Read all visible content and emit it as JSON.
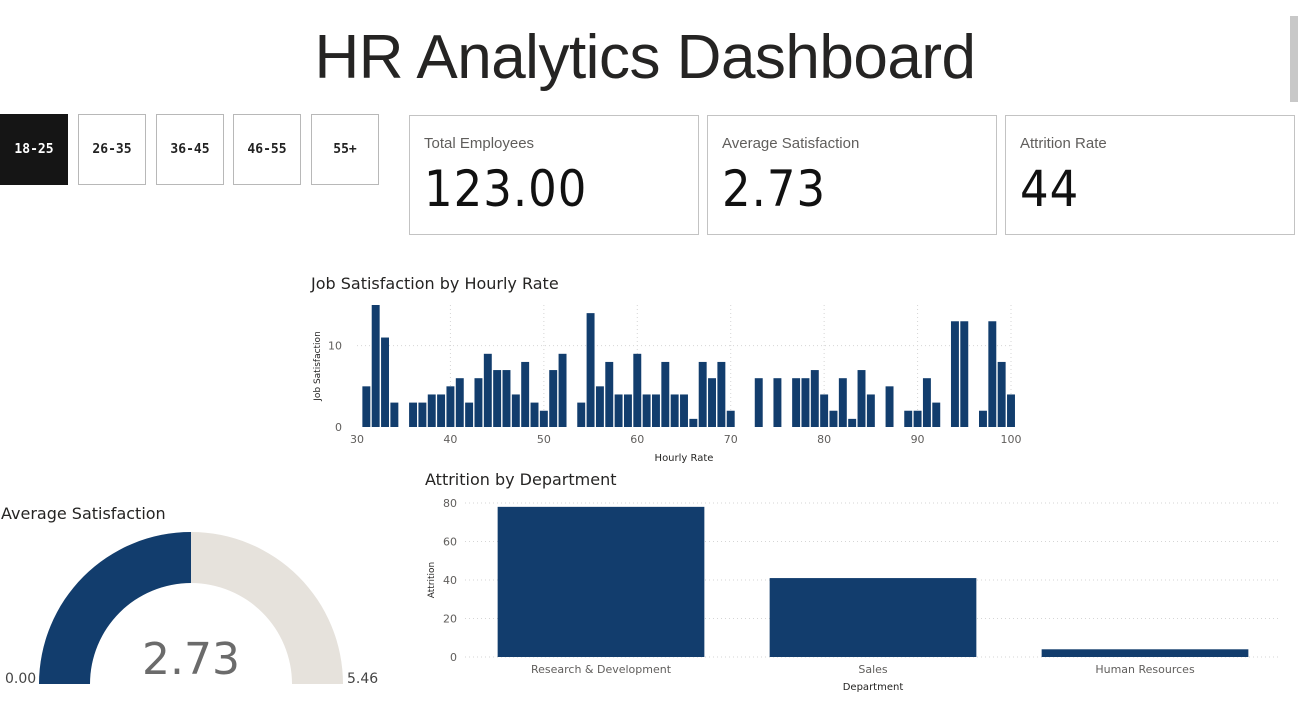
{
  "header": {
    "title": "HR Analytics Dashboard"
  },
  "age_filter": {
    "options": [
      "18-25",
      "26-35",
      "36-45",
      "46-55",
      "55+"
    ],
    "selected": "18-25"
  },
  "kpis": [
    {
      "label": "Total Employees",
      "value": "123.00"
    },
    {
      "label": "Average Satisfaction",
      "value": "2.73"
    },
    {
      "label": "Attrition Rate",
      "value": "44"
    }
  ],
  "colors": {
    "bar": "#123d6d",
    "gauge_empty": "#e6e2dc",
    "selected_button": "#151515"
  },
  "chart_data": [
    {
      "type": "bar",
      "title": "Job Satisfaction by Hourly Rate",
      "xlabel": "Hourly Rate",
      "ylabel": "Job Satisfaction",
      "xlim": [
        30,
        100
      ],
      "ylim": [
        0,
        15
      ],
      "x_ticks": [
        30,
        40,
        50,
        60,
        70,
        80,
        90,
        100
      ],
      "y_ticks": [
        0,
        10
      ],
      "x": [
        31,
        32,
        33,
        34,
        36,
        37,
        38,
        39,
        40,
        41,
        42,
        43,
        44,
        45,
        46,
        47,
        48,
        49,
        50,
        51,
        52,
        54,
        55,
        56,
        57,
        58,
        59,
        60,
        61,
        62,
        63,
        64,
        65,
        66,
        67,
        68,
        69,
        70,
        73,
        75,
        77,
        78,
        79,
        80,
        81,
        82,
        83,
        84,
        85,
        87,
        89,
        90,
        91,
        92,
        94,
        95,
        97,
        98,
        99,
        100
      ],
      "values": [
        5,
        15,
        11,
        3,
        3,
        3,
        4,
        4,
        5,
        6,
        3,
        6,
        9,
        7,
        7,
        4,
        8,
        3,
        2,
        7,
        9,
        3,
        14,
        5,
        8,
        4,
        4,
        9,
        4,
        4,
        8,
        4,
        4,
        1,
        8,
        6,
        8,
        2,
        6,
        6,
        6,
        6,
        7,
        4,
        2,
        6,
        1,
        7,
        4,
        5,
        2,
        2,
        6,
        3,
        13,
        13,
        2,
        13,
        8,
        4
      ],
      "grid": true
    },
    {
      "type": "bar",
      "title": "Attrition by Department",
      "xlabel": "Department",
      "ylabel": "Attrition",
      "categories": [
        "Research & Development",
        "Sales",
        "Human Resources"
      ],
      "values": [
        78,
        41,
        4
      ],
      "ylim": [
        0,
        80
      ],
      "y_ticks": [
        0,
        20,
        40,
        60,
        80
      ],
      "grid": true
    },
    {
      "type": "gauge",
      "title": "Average Satisfaction",
      "value": 2.73,
      "value_label": "2.73",
      "min": 0,
      "max": 5.46,
      "min_label": "0.00",
      "max_label": "5.46"
    }
  ]
}
